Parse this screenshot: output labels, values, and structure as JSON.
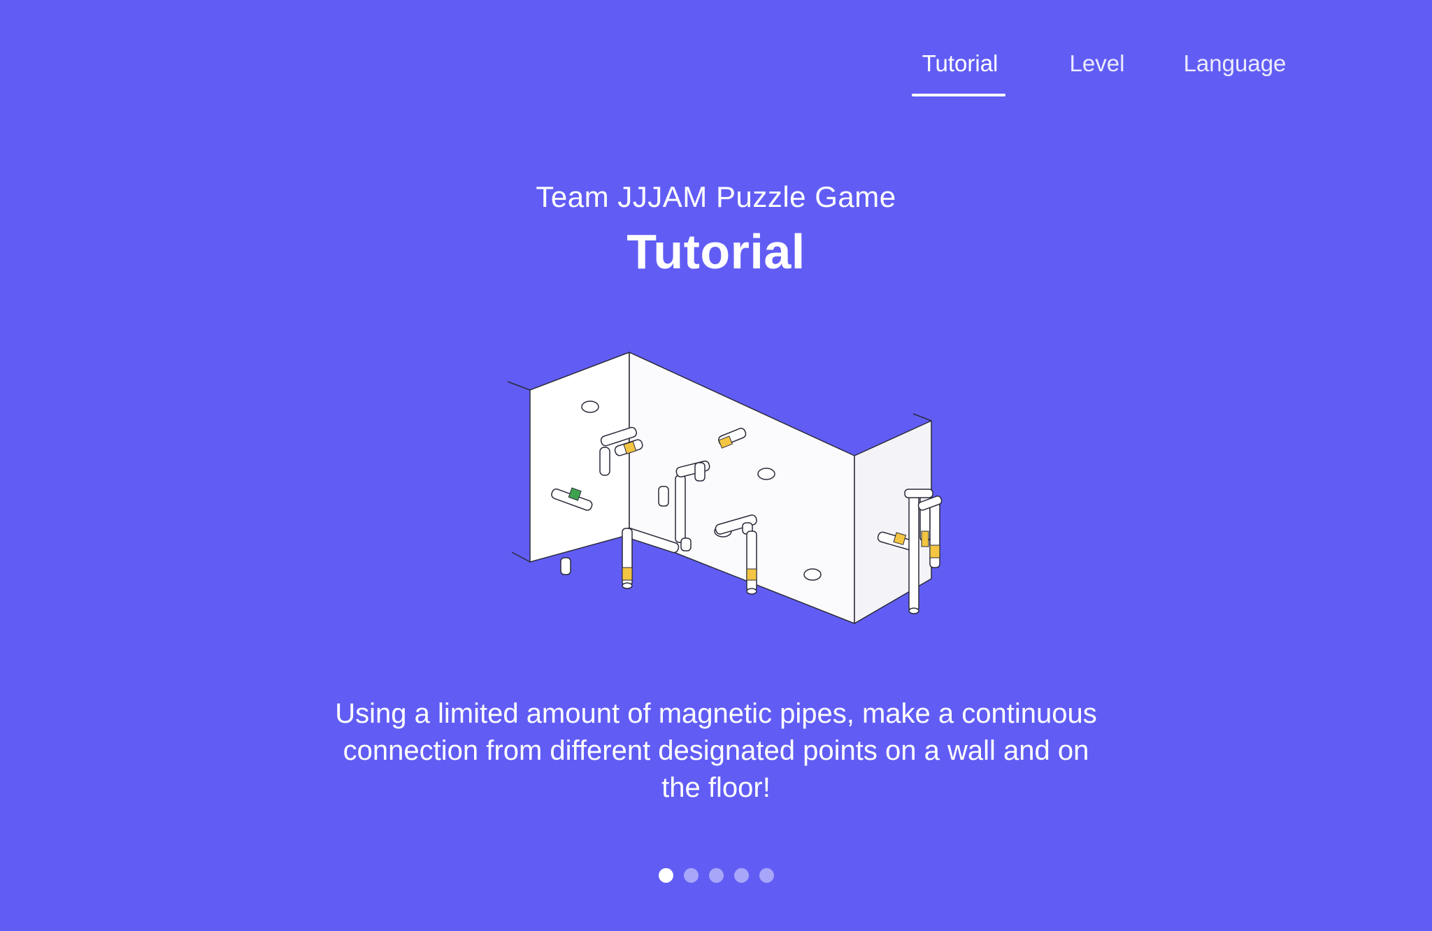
{
  "nav": {
    "items": [
      {
        "label": "Tutorial",
        "active": true
      },
      {
        "label": "Level",
        "active": false
      },
      {
        "label": "Language",
        "active": false
      }
    ]
  },
  "header": {
    "subtitle": "Team JJJAM Puzzle Game",
    "title": "Tutorial"
  },
  "illustration": {
    "icon": "magnetic-pipe-wall-illustration"
  },
  "description": {
    "text": "Using a limited amount of magnetic pipes, make a continuous connection from different designated points on a wall and on the floor!"
  },
  "pagination": {
    "total": 5,
    "current": 1
  },
  "colors": {
    "background": "#615df4",
    "accent_yellow": "#f3c542",
    "accent_green": "#3fa34d"
  }
}
